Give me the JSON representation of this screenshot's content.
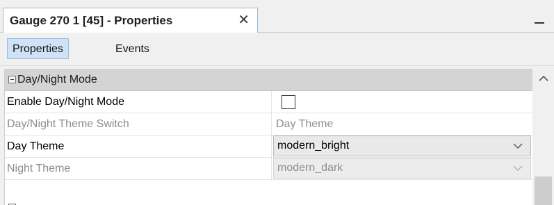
{
  "window": {
    "tab_title": "Gauge 270 1 [45] - Properties",
    "close_glyph": "✕"
  },
  "subtabs": [
    {
      "label": "Properties",
      "active": true
    },
    {
      "label": "Events",
      "active": false
    }
  ],
  "grid": {
    "category": "Day/Night Mode",
    "rows": [
      {
        "name": "Enable Day/Night Mode",
        "value": "",
        "type": "checkbox",
        "checked": false,
        "enabled": true
      },
      {
        "name": "Day/Night Theme Switch",
        "value": "Day Theme",
        "type": "text",
        "enabled": false
      },
      {
        "name": "Day Theme",
        "value": "modern_bright",
        "type": "combo",
        "enabled": true
      },
      {
        "name": "Night Theme",
        "value": "modern_dark",
        "type": "combo",
        "enabled": false
      }
    ]
  },
  "icons": {
    "close": "close-icon",
    "minimize": "minimize-icon",
    "expander": "collapse-icon",
    "dropdown": "chevron-down-icon",
    "scroll_up": "chevron-up-icon"
  },
  "colors": {
    "active_tab": "#cfe2f7",
    "category_band": "#d4d4d4",
    "disabled_text": "#8c8c8c"
  }
}
